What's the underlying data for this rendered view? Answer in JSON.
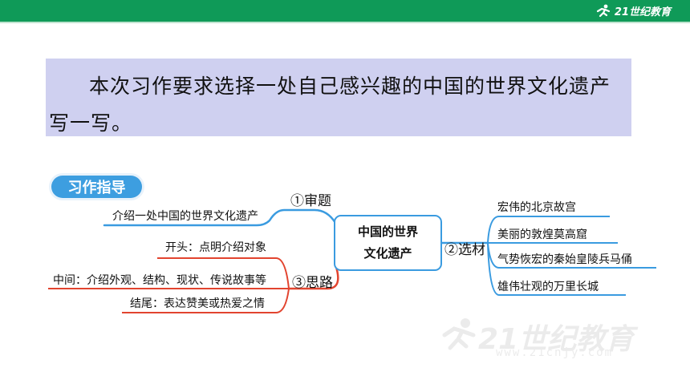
{
  "header": {
    "logo_text": "21世纪教育",
    "bar_color": "#0f9a58"
  },
  "prompt": {
    "text": "本次习作要求选择一处自己感兴趣的中国的世界文化遗产写一写。",
    "background": "#cfd0f0"
  },
  "guide": {
    "label": "习作指导",
    "color": "#3d9ee0"
  },
  "mindmap": {
    "center": {
      "line1": "中国的世界",
      "line2": "文化遗产"
    },
    "branches": {
      "review": {
        "label": "①审题",
        "items": [
          "介绍一处中国的世界文化遗产"
        ]
      },
      "material": {
        "label": "②选材",
        "items": [
          "宏伟的北京故宫",
          "美丽的敦煌莫高窟",
          "气势恢宏的秦始皇陵兵马俑",
          "雄伟壮观的万里长城"
        ]
      },
      "outline": {
        "label": "③思路",
        "items": [
          "开头：点明介绍对象",
          "中间：介绍外观、结构、现状、传说故事等",
          "结尾：表达赞美或热爱之情"
        ]
      }
    },
    "colors": {
      "blue": "#3a9be0",
      "red": "#e2442f"
    }
  },
  "watermark": {
    "main": "21世纪教育",
    "sub": "www.21cnjy.com"
  }
}
